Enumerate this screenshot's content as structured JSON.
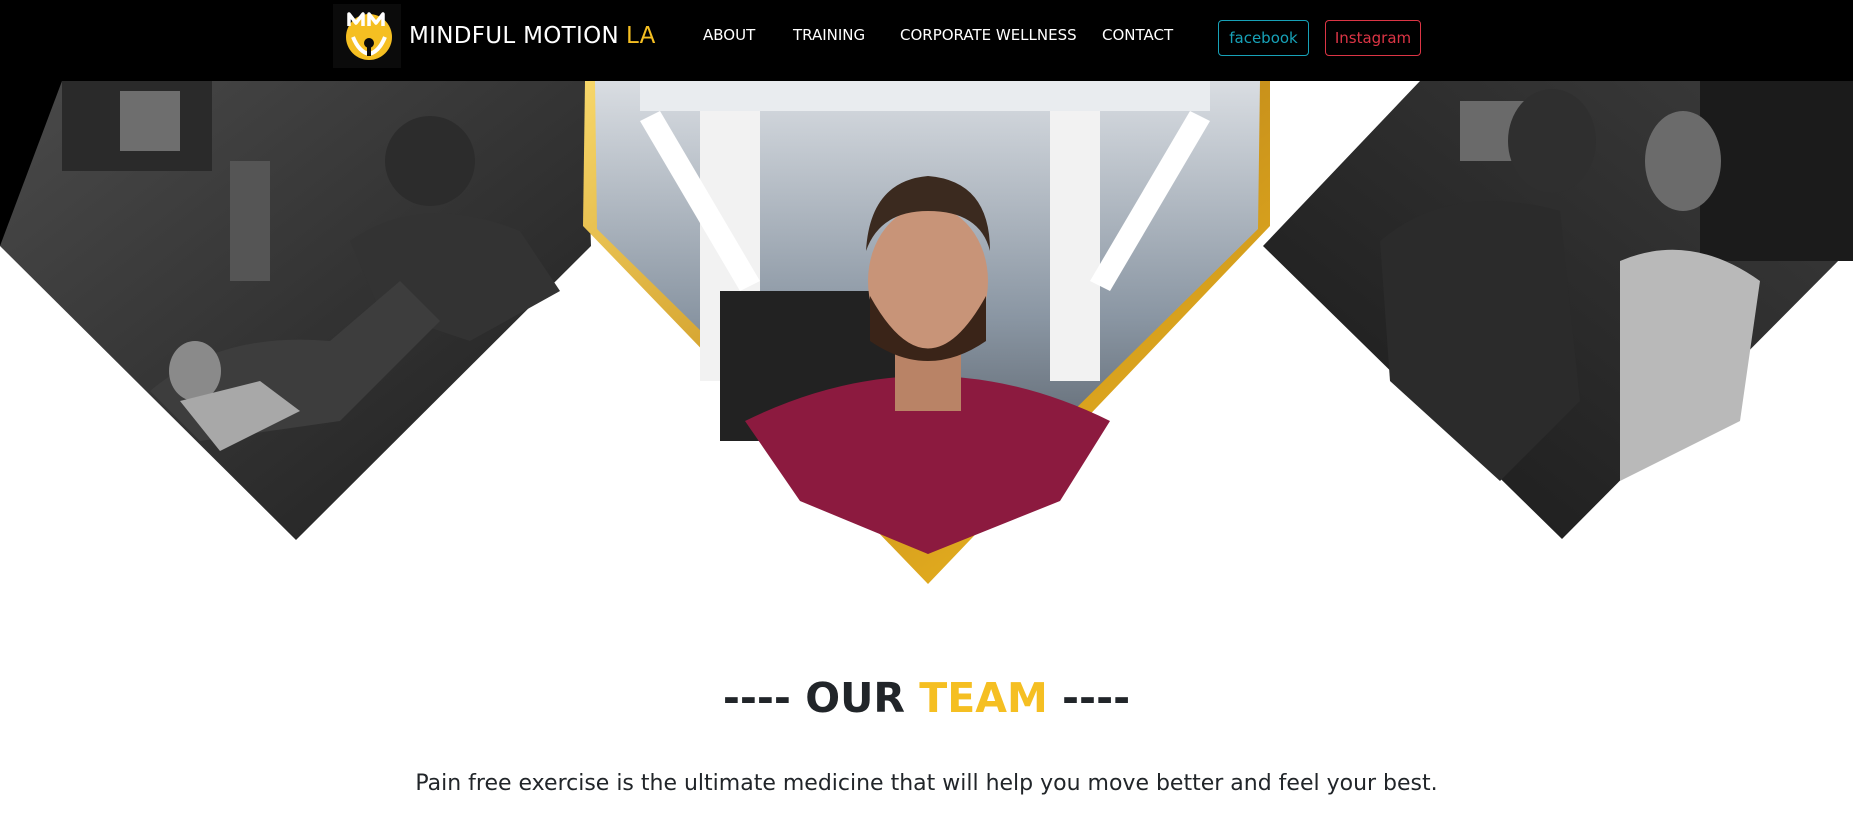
{
  "nav": {
    "brand_main": "MINDFUL MOTION",
    "brand_accent": "LA",
    "links": [
      "ABOUT",
      "TRAINING",
      "CORPORATE WELLNESS",
      "CONTACT"
    ],
    "facebook_label": "facebook",
    "instagram_label": "Instagram"
  },
  "section": {
    "dashes_left": "----",
    "title_main": "OUR",
    "title_accent": "TEAM",
    "dashes_right": "----",
    "tagline": "Pain free exercise is the ultimate medicine that will help you move better and feel your best."
  },
  "colors": {
    "accent": "#f5bf22",
    "navbar_bg": "#000000",
    "facebook": "#17a2b8",
    "instagram": "#dc3545",
    "text": "#212529"
  },
  "icons": {
    "logo": "mm-logo-icon"
  }
}
